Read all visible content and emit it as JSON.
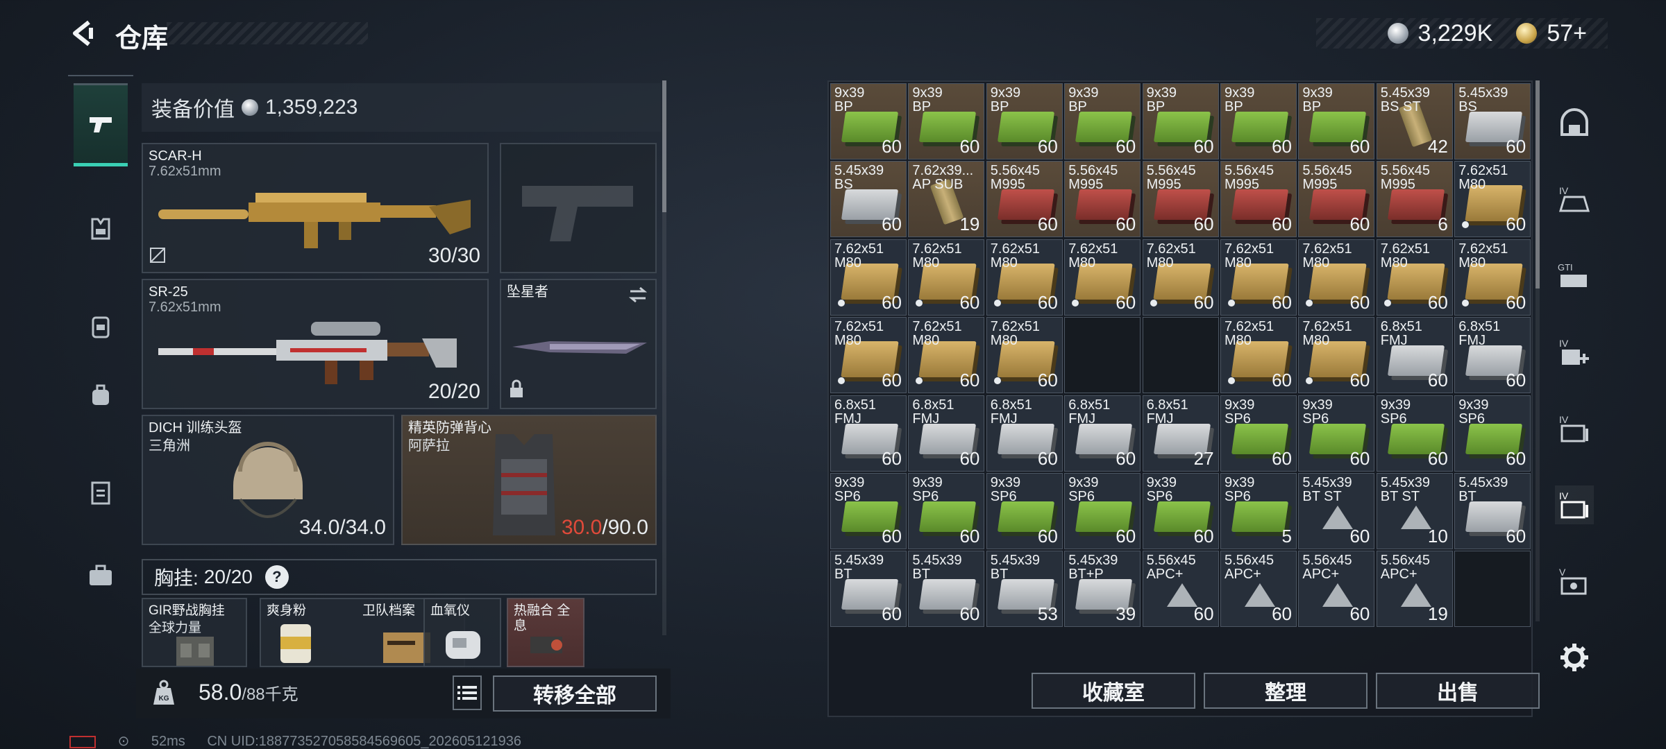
{
  "header": {
    "title": "仓库",
    "currency_silver": "3,229K",
    "currency_gold": "57+"
  },
  "loadout": {
    "value_label": "装备价值",
    "value_amount": "1,359,223",
    "primary": {
      "name": "SCAR-H",
      "caliber": "7.62x51mm",
      "ammo": "30/30"
    },
    "secondary": {
      "name": "SR-25",
      "caliber": "7.62x51mm",
      "ammo": "20/20"
    },
    "melee": {
      "name": "坠星者"
    },
    "helmet": {
      "name": "DICH 训练头盔",
      "sub": "三角洲",
      "durability": "34.0/34.0"
    },
    "armor": {
      "name": "精英防弹背心",
      "sub": "阿萨拉",
      "durability_current": "30.0",
      "durability_max": "/90.0"
    },
    "chest_rig": {
      "label": "胸挂:",
      "capacity": "20/20"
    },
    "rig_items": [
      {
        "name": "GIR野战胸挂",
        "sub": "全球力量"
      },
      {
        "name": "爽身粉",
        "sub": ""
      },
      {
        "name": "卫队档案",
        "sub": ""
      },
      {
        "name": "血氧仪",
        "sub": ""
      },
      {
        "name": "热融合 全息",
        "sub": ""
      }
    ],
    "weight_value": "58.0",
    "weight_max": "/88千克",
    "transfer_all": "转移全部"
  },
  "stash": {
    "cells": [
      {
        "cal": "9x39",
        "typ": "BP",
        "qty": "60",
        "box": "green",
        "bg": "brown"
      },
      {
        "cal": "9x39",
        "typ": "BP",
        "qty": "60",
        "box": "green",
        "bg": "brown"
      },
      {
        "cal": "9x39",
        "typ": "BP",
        "qty": "60",
        "box": "green",
        "bg": "brown"
      },
      {
        "cal": "9x39",
        "typ": "BP",
        "qty": "60",
        "box": "green",
        "bg": "brown"
      },
      {
        "cal": "9x39",
        "typ": "BP",
        "qty": "60",
        "box": "green",
        "bg": "brown"
      },
      {
        "cal": "9x39",
        "typ": "BP",
        "qty": "60",
        "box": "green",
        "bg": "brown"
      },
      {
        "cal": "9x39",
        "typ": "BP",
        "qty": "60",
        "box": "green",
        "bg": "brown"
      },
      {
        "cal": "5.45x39",
        "typ": "BS ST",
        "qty": "42",
        "box": "shell",
        "bg": "brown"
      },
      {
        "cal": "5.45x39",
        "typ": "BS",
        "qty": "60",
        "box": "white",
        "bg": "brown"
      },
      {
        "cal": "5.45x39",
        "typ": "BS",
        "qty": "60",
        "box": "white",
        "bg": "brown"
      },
      {
        "cal": "7.62x39...",
        "typ": "AP SUB",
        "qty": "19",
        "box": "shell",
        "bg": "brown"
      },
      {
        "cal": "5.56x45",
        "typ": "M995",
        "qty": "60",
        "box": "red",
        "bg": "brown"
      },
      {
        "cal": "5.56x45",
        "typ": "M995",
        "qty": "60",
        "box": "red",
        "bg": "brown"
      },
      {
        "cal": "5.56x45",
        "typ": "M995",
        "qty": "60",
        "box": "red",
        "bg": "brown"
      },
      {
        "cal": "5.56x45",
        "typ": "M995",
        "qty": "60",
        "box": "red",
        "bg": "brown"
      },
      {
        "cal": "5.56x45",
        "typ": "M995",
        "qty": "60",
        "box": "red",
        "bg": "brown"
      },
      {
        "cal": "5.56x45",
        "typ": "M995",
        "qty": "6",
        "box": "red",
        "bg": "brown"
      },
      {
        "cal": "7.62x51",
        "typ": "M80",
        "qty": "60",
        "box": "tan",
        "bg": "blue",
        "dot": true
      },
      {
        "cal": "7.62x51",
        "typ": "M80",
        "qty": "60",
        "box": "tan",
        "bg": "blue",
        "dot": true
      },
      {
        "cal": "7.62x51",
        "typ": "M80",
        "qty": "60",
        "box": "tan",
        "bg": "blue",
        "dot": true
      },
      {
        "cal": "7.62x51",
        "typ": "M80",
        "qty": "60",
        "box": "tan",
        "bg": "blue",
        "dot": true
      },
      {
        "cal": "7.62x51",
        "typ": "M80",
        "qty": "60",
        "box": "tan",
        "bg": "blue",
        "dot": true
      },
      {
        "cal": "7.62x51",
        "typ": "M80",
        "qty": "60",
        "box": "tan",
        "bg": "blue",
        "dot": true
      },
      {
        "cal": "7.62x51",
        "typ": "M80",
        "qty": "60",
        "box": "tan",
        "bg": "blue",
        "dot": true
      },
      {
        "cal": "7.62x51",
        "typ": "M80",
        "qty": "60",
        "box": "tan",
        "bg": "blue",
        "dot": true
      },
      {
        "cal": "7.62x51",
        "typ": "M80",
        "qty": "60",
        "box": "tan",
        "bg": "blue",
        "dot": true
      },
      {
        "cal": "7.62x51",
        "typ": "M80",
        "qty": "60",
        "box": "tan",
        "bg": "blue",
        "dot": true
      },
      {
        "cal": "7.62x51",
        "typ": "M80",
        "qty": "60",
        "box": "tan",
        "bg": "blue",
        "dot": true
      },
      {
        "cal": "7.62x51",
        "typ": "M80",
        "qty": "60",
        "box": "tan",
        "bg": "blue",
        "dot": true
      },
      {
        "cal": "7.62x51",
        "typ": "M80",
        "qty": "60",
        "box": "tan",
        "bg": "blue",
        "dot": true
      },
      {
        "cal": "",
        "typ": "",
        "qty": "",
        "box": "none",
        "bg": "empty"
      },
      {
        "cal": "",
        "typ": "",
        "qty": "",
        "box": "none",
        "bg": "empty"
      },
      {
        "cal": "7.62x51",
        "typ": "M80",
        "qty": "60",
        "box": "tan",
        "bg": "blue",
        "dot": true
      },
      {
        "cal": "7.62x51",
        "typ": "M80",
        "qty": "60",
        "box": "tan",
        "bg": "blue",
        "dot": true
      },
      {
        "cal": "6.8x51",
        "typ": "FMJ",
        "qty": "60",
        "box": "white",
        "bg": "blue"
      },
      {
        "cal": "6.8x51",
        "typ": "FMJ",
        "qty": "60",
        "box": "white",
        "bg": "blue"
      },
      {
        "cal": "6.8x51",
        "typ": "FMJ",
        "qty": "60",
        "box": "white",
        "bg": "blue"
      },
      {
        "cal": "6.8x51",
        "typ": "FMJ",
        "qty": "60",
        "box": "white",
        "bg": "blue"
      },
      {
        "cal": "6.8x51",
        "typ": "FMJ",
        "qty": "60",
        "box": "white",
        "bg": "blue"
      },
      {
        "cal": "6.8x51",
        "typ": "FMJ",
        "qty": "60",
        "box": "white",
        "bg": "blue"
      },
      {
        "cal": "6.8x51",
        "typ": "FMJ",
        "qty": "27",
        "box": "white",
        "bg": "blue"
      },
      {
        "cal": "9x39",
        "typ": "SP6",
        "qty": "60",
        "box": "green",
        "bg": "blue"
      },
      {
        "cal": "9x39",
        "typ": "SP6",
        "qty": "60",
        "box": "green",
        "bg": "blue"
      },
      {
        "cal": "9x39",
        "typ": "SP6",
        "qty": "60",
        "box": "green",
        "bg": "blue"
      },
      {
        "cal": "9x39",
        "typ": "SP6",
        "qty": "60",
        "box": "green",
        "bg": "blue"
      },
      {
        "cal": "9x39",
        "typ": "SP6",
        "qty": "60",
        "box": "green",
        "bg": "blue"
      },
      {
        "cal": "9x39",
        "typ": "SP6",
        "qty": "60",
        "box": "green",
        "bg": "blue"
      },
      {
        "cal": "9x39",
        "typ": "SP6",
        "qty": "60",
        "box": "green",
        "bg": "blue"
      },
      {
        "cal": "9x39",
        "typ": "SP6",
        "qty": "60",
        "box": "green",
        "bg": "blue"
      },
      {
        "cal": "9x39",
        "typ": "SP6",
        "qty": "60",
        "box": "green",
        "bg": "blue"
      },
      {
        "cal": "9x39",
        "typ": "SP6",
        "qty": "5",
        "box": "green",
        "bg": "blue"
      },
      {
        "cal": "5.45x39",
        "typ": "BT ST",
        "qty": "60",
        "box": "tri",
        "bg": "blue"
      },
      {
        "cal": "5.45x39",
        "typ": "BT ST",
        "qty": "10",
        "box": "tri",
        "bg": "blue"
      },
      {
        "cal": "5.45x39",
        "typ": "BT",
        "qty": "60",
        "box": "white",
        "bg": "blue"
      },
      {
        "cal": "5.45x39",
        "typ": "BT",
        "qty": "60",
        "box": "white",
        "bg": "blue"
      },
      {
        "cal": "5.45x39",
        "typ": "BT",
        "qty": "60",
        "box": "white",
        "bg": "blue"
      },
      {
        "cal": "5.45x39",
        "typ": "BT",
        "qty": "53",
        "box": "white",
        "bg": "blue"
      },
      {
        "cal": "5.45x39",
        "typ": "BT+P",
        "qty": "39",
        "box": "white",
        "bg": "blue"
      },
      {
        "cal": "5.56x45",
        "typ": "APC+",
        "qty": "60",
        "box": "tri",
        "bg": "blue"
      },
      {
        "cal": "5.56x45",
        "typ": "APC+",
        "qty": "60",
        "box": "tri",
        "bg": "blue"
      },
      {
        "cal": "5.56x45",
        "typ": "APC+",
        "qty": "60",
        "box": "tri",
        "bg": "blue"
      },
      {
        "cal": "5.56x45",
        "typ": "APC+",
        "qty": "19",
        "box": "tri",
        "bg": "blue"
      },
      {
        "cal": "",
        "typ": "",
        "qty": "",
        "box": "none",
        "bg": "empty"
      }
    ],
    "buttons": {
      "collection": "收藏室",
      "organize": "整理",
      "sell": "出售"
    }
  },
  "status": {
    "ping": "52ms",
    "uid": "CN UID:188773527058584569605_202605121936"
  },
  "colors": {
    "accent": "#3ad0b4",
    "armor_low": "#e04a3a"
  }
}
